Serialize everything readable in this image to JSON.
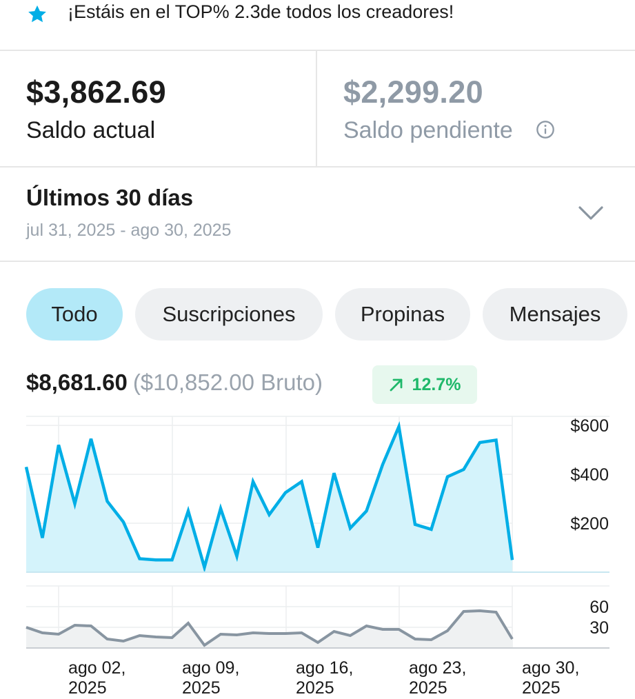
{
  "banner": {
    "icon": "star-icon",
    "text": "¡Estáis en el TOP% 2.3de todos los creadores!"
  },
  "balances": {
    "current": {
      "amount": "$3,862.69",
      "label": "Saldo actual"
    },
    "pending": {
      "amount": "$2,299.20",
      "label": "Saldo pendiente",
      "icon": "info-icon"
    }
  },
  "period": {
    "title": "Últimos 30 días",
    "range": "jul 31, 2025 - ago 30, 2025"
  },
  "tabs": [
    {
      "label": "Todo",
      "active": true
    },
    {
      "label": "Suscripciones",
      "active": false
    },
    {
      "label": "Propinas",
      "active": false
    },
    {
      "label": "Mensajes",
      "active": false
    }
  ],
  "summary": {
    "net": "$8,681.60",
    "gross": "($10,852.00 Bruto)",
    "change": "12.7%",
    "change_direction": "up"
  },
  "colors": {
    "accent": "#00aee6",
    "accent_fill": "#d4f3fb",
    "count_line": "#8895a1",
    "positive": "#1fb86a",
    "active_tab": "#b3e9f8"
  },
  "chart_data": [
    {
      "type": "area",
      "x_ticks": [
        "ago 02, 2025",
        "ago 09, 2025",
        "ago 16, 2025",
        "ago 23, 2025",
        "ago 30, 2025"
      ],
      "y_ticks": [
        "$200",
        "$400",
        "$600"
      ],
      "ylim": [
        0,
        620
      ],
      "x": [
        "jul 31",
        "ago 01",
        "ago 02",
        "ago 03",
        "ago 04",
        "ago 05",
        "ago 06",
        "ago 07",
        "ago 08",
        "ago 09",
        "ago 10",
        "ago 11",
        "ago 12",
        "ago 13",
        "ago 14",
        "ago 15",
        "ago 16",
        "ago 17",
        "ago 18",
        "ago 19",
        "ago 20",
        "ago 21",
        "ago 22",
        "ago 23",
        "ago 24",
        "ago 25",
        "ago 26",
        "ago 27",
        "ago 28",
        "ago 29",
        "ago 30"
      ],
      "values": [
        430,
        140,
        520,
        280,
        545,
        290,
        205,
        55,
        50,
        50,
        250,
        20,
        260,
        65,
        370,
        235,
        325,
        370,
        100,
        405,
        180,
        250,
        440,
        595,
        195,
        175,
        390,
        420,
        530,
        540,
        50
      ],
      "grid": true
    },
    {
      "type": "area",
      "x_ticks": [
        "ago 02, 2025",
        "ago 09, 2025",
        "ago 16, 2025",
        "ago 23, 2025",
        "ago 30, 2025"
      ],
      "y_ticks": [
        "30",
        "60"
      ],
      "ylim": [
        0,
        80
      ],
      "x": [
        "jul 31",
        "ago 01",
        "ago 02",
        "ago 03",
        "ago 04",
        "ago 05",
        "ago 06",
        "ago 07",
        "ago 08",
        "ago 09",
        "ago 10",
        "ago 11",
        "ago 12",
        "ago 13",
        "ago 14",
        "ago 15",
        "ago 16",
        "ago 17",
        "ago 18",
        "ago 19",
        "ago 20",
        "ago 21",
        "ago 22",
        "ago 23",
        "ago 24",
        "ago 25",
        "ago 26",
        "ago 27",
        "ago 28",
        "ago 29",
        "ago 30"
      ],
      "values": [
        30,
        22,
        20,
        33,
        32,
        13,
        10,
        18,
        16,
        15,
        36,
        4,
        20,
        19,
        22,
        21,
        21,
        22,
        8,
        24,
        18,
        32,
        27,
        27,
        13,
        12,
        25,
        53,
        54,
        52,
        13
      ],
      "grid": true
    }
  ]
}
